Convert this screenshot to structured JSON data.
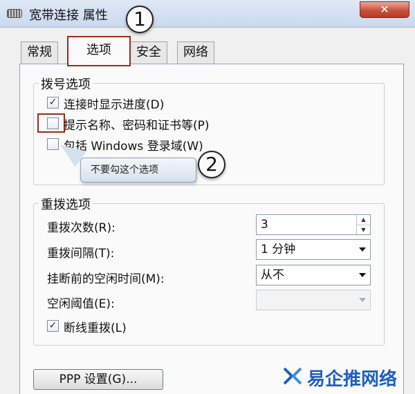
{
  "window": {
    "title": "宽带连接 属性",
    "close_glyph": "✕"
  },
  "annotations": {
    "step1": "1",
    "step2": "2",
    "callout": "不要勾这个选项"
  },
  "tabs": [
    {
      "label": "常规",
      "active": false
    },
    {
      "label": "选项",
      "active": true
    },
    {
      "label": "安全",
      "active": false
    },
    {
      "label": "网络",
      "active": false
    }
  ],
  "dial_options": {
    "legend": "拨号选项",
    "items": [
      {
        "label": "连接时显示进度(D)",
        "checked": true
      },
      {
        "label": "提示名称、密码和证书等(P)",
        "checked": false
      },
      {
        "label": "包括 Windows 登录域(W)",
        "checked": false
      }
    ]
  },
  "redial_options": {
    "legend": "重拨选项",
    "redial_count_label": "重拨次数(R):",
    "redial_count_value": "3",
    "redial_interval_label": "重拨间隔(T):",
    "redial_interval_value": "1 分钟",
    "idle_before_hangup_label": "挂断前的空闲时间(M):",
    "idle_before_hangup_value": "从不",
    "idle_threshold_label": "空闲阈值(E):",
    "idle_threshold_value": "",
    "redial_if_dropped_label": "断线重拨(L)",
    "redial_if_dropped_checked": true
  },
  "ppp_button_label": "PPP 设置(G)...",
  "watermark": "易企推网络",
  "colors": {
    "highlight_box": "#9c2a1f",
    "watermark": "#1f5fbf",
    "close_button": "#c9523c"
  }
}
